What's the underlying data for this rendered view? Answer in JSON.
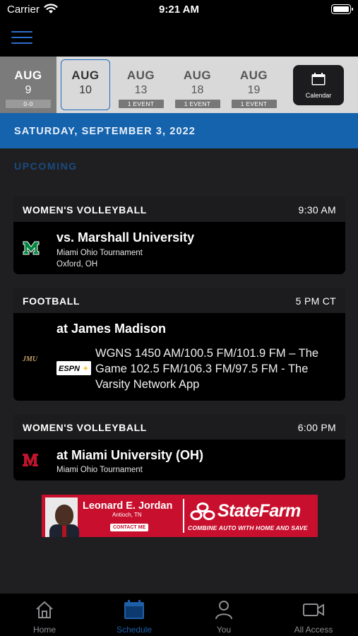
{
  "status_bar": {
    "carrier": "Carrier",
    "time": "9:21 AM"
  },
  "date_strip": {
    "dates": [
      {
        "month": "AUG",
        "day": "9",
        "badge": "0-0",
        "state": "past"
      },
      {
        "month": "AUG",
        "day": "10",
        "badge": "",
        "state": "selected"
      },
      {
        "month": "AUG",
        "day": "13",
        "badge": "1 EVENT",
        "state": "upcoming"
      },
      {
        "month": "AUG",
        "day": "18",
        "badge": "1 EVENT",
        "state": "upcoming"
      },
      {
        "month": "AUG",
        "day": "19",
        "badge": "1 EVENT",
        "state": "upcoming"
      }
    ],
    "calendar_label": "Calendar"
  },
  "date_header": "SATURDAY, SEPTEMBER 3, 2022",
  "section_label": "UPCOMING",
  "events": [
    {
      "sport": "WOMEN'S VOLLEYBALL",
      "time": "9:30 AM",
      "opponent": "vs. Marshall University",
      "tournament": "Miami Ohio Tournament",
      "location": "Oxford, OH",
      "logo": "marshall-logo"
    },
    {
      "sport": "FOOTBALL",
      "time": "5 PM CT",
      "opponent": "at James Madison",
      "logo": "jmu-logo",
      "broadcast_logo": "ESPN+",
      "radio": "WGNS 1450 AM/100.5 FM/101.9 FM – The Game 102.5 FM/106.3 FM/97.5 FM - The Varsity Network App"
    },
    {
      "sport": "WOMEN'S VOLLEYBALL",
      "time": "6:00 PM",
      "opponent": "at Miami University (OH)",
      "tournament": "Miami Ohio Tournament",
      "logo": "miami-logo"
    }
  ],
  "ad": {
    "agent_name": "Leonard E. Jordan",
    "agent_location": "Antioch, TN",
    "contact_label": "CONTACT ME",
    "brand": "StateFarm",
    "tagline": "COMBINE AUTO WITH HOME AND SAVE"
  },
  "tab_bar": {
    "tabs": [
      {
        "label": "Home",
        "icon": "home-icon"
      },
      {
        "label": "Schedule",
        "icon": "calendar-icon",
        "active": true
      },
      {
        "label": "You",
        "icon": "person-icon"
      },
      {
        "label": "All Access",
        "icon": "video-camera-icon"
      }
    ]
  },
  "colors": {
    "accent_blue": "#1563ad",
    "tab_active": "#1d5fa8",
    "statefarm_red": "#c8102e"
  }
}
